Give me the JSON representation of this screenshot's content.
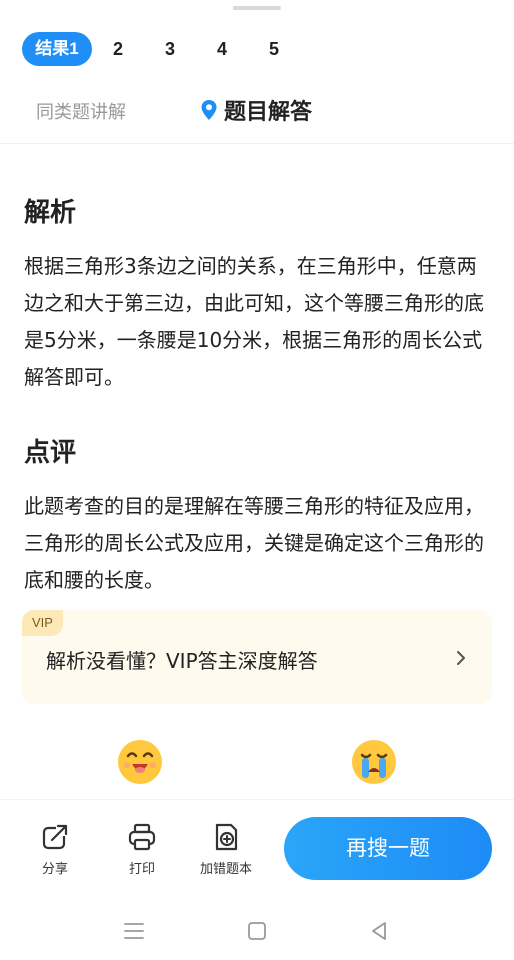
{
  "result_tabs": [
    {
      "label": "结果1",
      "active": true
    },
    {
      "label": "2",
      "active": false
    },
    {
      "label": "3",
      "active": false
    },
    {
      "label": "4",
      "active": false
    },
    {
      "label": "5",
      "active": false
    }
  ],
  "sub_tabs": {
    "similar": "同类题讲解",
    "answer": "题目解答"
  },
  "analysis": {
    "title": "解析",
    "body": "根据三角形3条边之间的关系，在三角形中，任意两边之和大于第三边，由此可知，这个等腰三角形的底是5分米，一条腰是10分米，根据三角形的周长公式解答即可。"
  },
  "comment": {
    "title": "点评",
    "body": "此题考查的目的是理解在等腰三角形的特征及应用，三角形的周长公式及应用，关键是确定这个三角形的底和腰的长度。"
  },
  "vip": {
    "badge": "VIP",
    "text": "解析没看懂？VIP答主深度解答"
  },
  "toolbar": {
    "share_label": "分享",
    "print_label": "打印",
    "add_wrong_label": "加错题本",
    "search_again_label": "再搜一题"
  },
  "colors": {
    "accent": "#1f8ff7",
    "vip_bg": "#fffaee",
    "vip_badge": "#fde9b8"
  }
}
